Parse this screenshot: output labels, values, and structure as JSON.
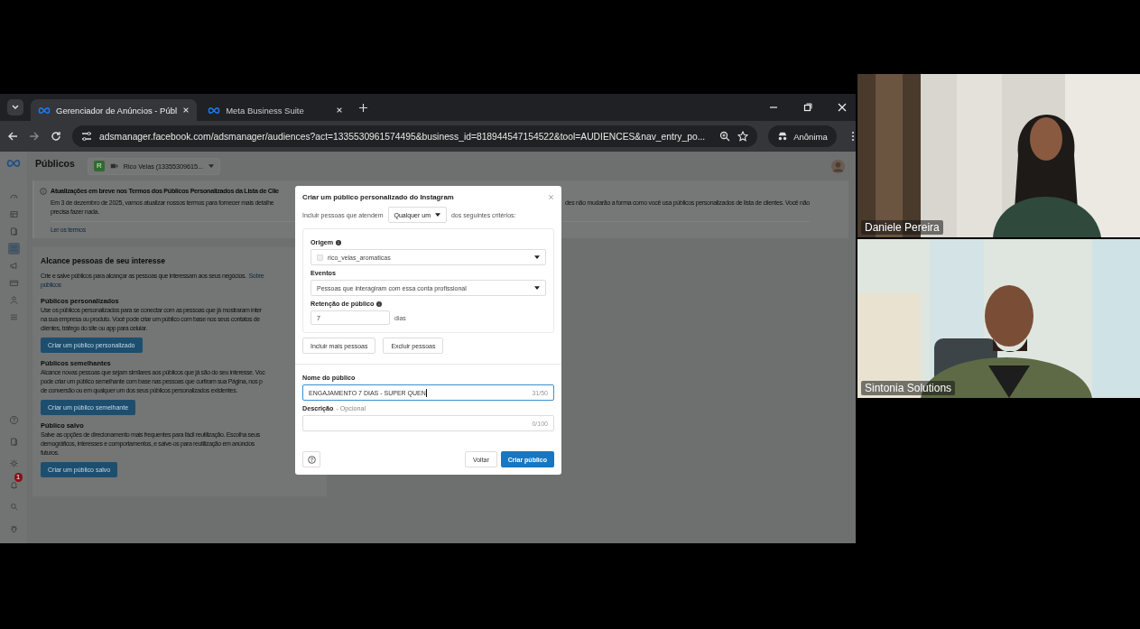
{
  "browser": {
    "tabs": [
      {
        "title": "Gerenciador de Anúncios - Públ",
        "selected": true
      },
      {
        "title": "Meta Business Suite",
        "selected": false
      }
    ],
    "url": "adsmanager.facebook.com/adsmanager/audiences?act=1335530961574495&business_id=818944547154522&tool=AUDIENCES&nav_entry_po...",
    "profile": "Anônima"
  },
  "page": {
    "title": "Públicos",
    "account": {
      "badge": "R",
      "name": "Rico Velas (13355309615..."
    },
    "sidebar": {
      "items": [
        {
          "kind": "gauge",
          "selected": false
        },
        {
          "kind": "table",
          "selected": false
        },
        {
          "kind": "pages",
          "selected": false
        },
        {
          "kind": "people",
          "selected": true
        },
        {
          "kind": "megaphone",
          "selected": false
        },
        {
          "kind": "card",
          "selected": false
        },
        {
          "kind": "person",
          "selected": false
        },
        {
          "kind": "menu",
          "selected": false
        }
      ],
      "bottom_items": [
        {
          "kind": "help",
          "selected": false
        },
        {
          "kind": "pages",
          "selected": false
        },
        {
          "kind": "gear",
          "selected": false
        },
        {
          "kind": "bell",
          "selected": false,
          "badge": "1"
        },
        {
          "kind": "search",
          "selected": false
        },
        {
          "kind": "bug",
          "selected": false
        }
      ]
    },
    "notice": {
      "title": "Atualizações em breve nos Termos dos Públicos Personalizados da Lista de Clie",
      "line_1": "Em 3 de dezembro de 2025, vamos atualizar nossos termos para fornecer mais detalhe",
      "line_1_right": "des não mudarão a forma como você usa públicos personalizados de lista de clientes. Você não",
      "line_2": "precisa fazer nada.",
      "link": "Ler os termos"
    },
    "reach": {
      "title": "Alcance pessoas de seu interesse",
      "intro": "Crie e salve públicos para alcançar as pessoas que interessam aos seus negócios.",
      "intro_link_lines": [
        "Sobre",
        "públicos"
      ],
      "sections": [
        {
          "title": "Públicos personalizados",
          "lines": [
            "Use os públicos personalizados para se conectar com as pessoas que já mostraram inter",
            "na sua empresa ou produto. Você pode criar um público com base nos seus contatos de",
            "clientes, tráfego do site ou app para celular."
          ],
          "button": "Criar um público personalizado"
        },
        {
          "title": "Públicos semelhantes",
          "lines": [
            "Alcance novas pessoas que sejam similares aos públicos que já são do seu interesse. Voc",
            "pode criar um público semelhante com base nas pessoas que curtiram sua Página, nos p",
            "de conversão ou em qualquer um dos seus públicos personalizados existentes."
          ],
          "button": "Criar um público semelhante"
        },
        {
          "title": "Público salvo",
          "lines": [
            "Salve as opções de direcionamento mais frequentes para fácil reutilização. Escolha seus",
            "demográficos, interesses e comportamentos, e salve-os para reutilização em anúncios",
            "futuros."
          ],
          "button": "Criar um público salvo"
        }
      ]
    }
  },
  "dialog": {
    "title": "Criar um público personalizado do Instagram",
    "include_prefix": "Incluir pessoas que atendem",
    "match": "Qualquer um",
    "include_suffix": "dos seguintes critérios:",
    "origin_label": "Origem",
    "origin": "rico_velas_aromaticas",
    "events_label": "Eventos",
    "event": "Pessoas que interagiram com essa conta profissional",
    "retention_label": "Retenção de público",
    "retention": "7",
    "retention_unit": "dias",
    "include_more": "Incluir mais pessoas",
    "exclude": "Excluir pessoas",
    "name_label": "Nome do público",
    "name_value": "ENGAJAMENTO 7 DIAS - SUPER QUEN",
    "name_count": "31/50",
    "name_focused": true,
    "description_label": "Descrição",
    "description_hint": "- Opcional",
    "description_count": "0/100",
    "back": "Voltar",
    "create": "Criar público"
  },
  "participants": [
    {
      "name": "Daniele Pereira",
      "kind": "picture"
    },
    {
      "name": "Sintonia Solutions",
      "kind": "picture"
    }
  ]
}
